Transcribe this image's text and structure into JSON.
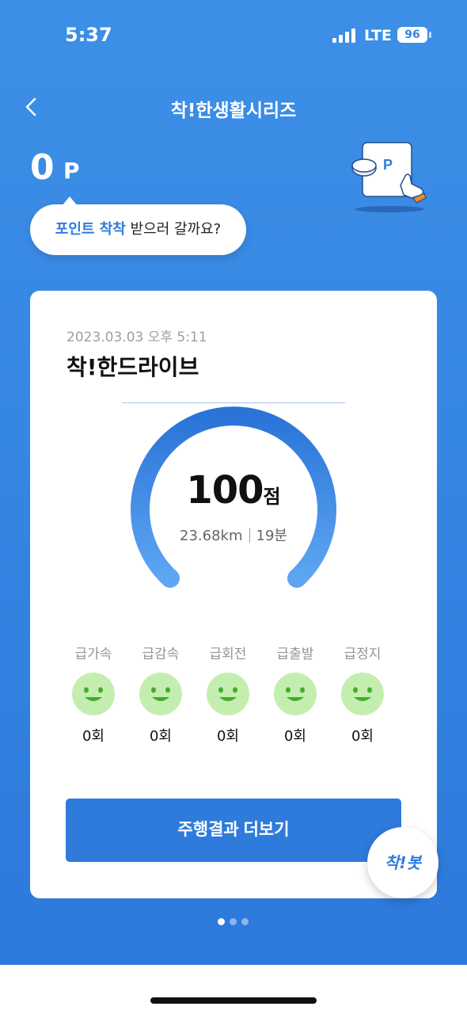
{
  "status_bar": {
    "time": "5:37",
    "network": "LTE",
    "battery": "96"
  },
  "nav": {
    "title": "착!한생활시리즈",
    "back_icon": "chevron-left-icon"
  },
  "points": {
    "value": "0",
    "unit": "P"
  },
  "bubble": {
    "highlight": "포인트 착착",
    "rest": " 받으러 갈까요?"
  },
  "card": {
    "date": "2023.03.03 오후 5:11",
    "title": "착!한드라이브",
    "score": {
      "value": "100",
      "unit": "점"
    },
    "distance": "23.68km",
    "duration": "19분",
    "events": [
      {
        "label": "급가속",
        "count": "0회",
        "icon": "smiley-icon"
      },
      {
        "label": "급감속",
        "count": "0회",
        "icon": "smiley-icon"
      },
      {
        "label": "급회전",
        "count": "0회",
        "icon": "smiley-icon"
      },
      {
        "label": "급출발",
        "count": "0회",
        "icon": "smiley-icon"
      },
      {
        "label": "급정지",
        "count": "0회",
        "icon": "smiley-icon"
      }
    ],
    "button_label": "주행결과 더보기"
  },
  "fab": {
    "label": "착!봇"
  },
  "pager": {
    "page_count": 3,
    "active_index": 0
  },
  "colors": {
    "background": "#3686e3",
    "accent": "#2e7bdc",
    "smiley_face": "#c4eeaf",
    "smiley_features": "#3fae2a"
  }
}
